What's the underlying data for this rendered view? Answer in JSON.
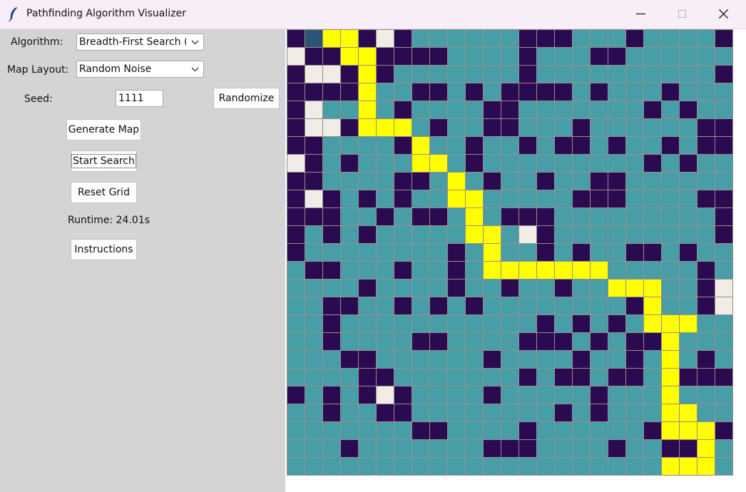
{
  "window": {
    "title": "Pathfinding Algorithm Visualizer"
  },
  "controls": {
    "algorithm_label": "Algorithm:",
    "algorithm_value": "Breadth-First Search (B",
    "layout_label": "Map Layout:",
    "layout_value": "Random Noise",
    "seed_label": "Seed:",
    "seed_value": "1111",
    "randomize_label": "Randomize",
    "generate_label": "Generate Map",
    "start_label": "Start Search",
    "reset_label": "Reset Grid",
    "runtime_text": "Runtime: 24.01s",
    "instructions_label": "Instructions"
  },
  "colors": {
    "wall": "#2a0a50",
    "visited": "#479ea6",
    "path": "#ffff00",
    "unvisited": "#f0ede6",
    "start": "#2c5578",
    "grid_line": "#9c8c8c"
  },
  "grid": {
    "legend": "W=wall, V=visited, P=path, E=unvisited, S=start",
    "rows": [
      "WSPPWEWVVVVVVWWWVVVWVVVVW",
      "EWWPPWWWWVVVVWVVVWWVVVVVV",
      "WEEWPWVVVVVVVWVVVVVVVVVVW",
      "WWWWPVVWWVWVWWWWVWVVVWVVV",
      "WEVVPVWVVVVWWVVVVVVVWVWVV",
      "WEEWPPPVWVVWWVVVWVVVVVVWW",
      "WWVVVVWPVVWVVWVWWVWVVWVWW",
      "EWVWVVVPPVWVVVVVVVVVWVWVV",
      "WWVVVVWWVPVWVVWVVWWVVVVVV",
      "WEWVWVWVVPPVVVVVWWWVVVVWW",
      "WWWVVWVWWVPVWWWVVVVVVVVVW",
      "WVWVWVVVVVPPVEWVVVVVVVVVW",
      "WVVVVVVVVWVPVVWVWVVWWVWVV",
      "VWWVVVWVVWVPPPPPPPVVVVVWV",
      "VVVVWVVVVWVVWVVWVVPPPVVWE",
      "VVWWVVWVWVWVVVVVVVVWPVVWE",
      "VVWVVVVVVVVVVVWVWVWVPPPVV",
      "VVWVVVVWWVVVVWWWVWVWWPVVV",
      "VVVWWVVVVVVWVVVVWVVWVPVWV",
      "VVVVWWVVVVVVVWVWWVWWVPWWW",
      "WVWVWEWVVVVWVVVVVWVVVPVVV",
      "VVWVVWWVVVVVVVVWVWVVVPPVV",
      "VVVVVVVWWVVVVWVVVVVVWPPPW",
      "VVVWVVVVVVVWWWVVVVWVVWWPV",
      "VVVVVVVVVVVVVVVVVVVVVPPPV"
    ]
  }
}
